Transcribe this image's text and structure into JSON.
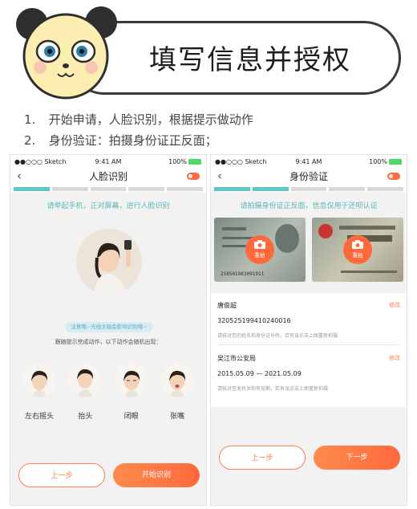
{
  "header": {
    "title": "填写信息并授权"
  },
  "steps": [
    {
      "num": "1.",
      "text": "开始申请，人脸识别，根据提示做动作"
    },
    {
      "num": "2.",
      "text": "身份验证：拍摄身份证正反面；"
    }
  ],
  "status": {
    "carrier": "●●○○○ Sketch",
    "time": "9:41 AM",
    "battery": "100%"
  },
  "face_screen": {
    "title": "人脸识别",
    "progress": [
      true,
      false,
      false,
      false,
      false
    ],
    "hint": "请举起手机，正对屏幕，进行人脸识别",
    "notice": "注意哦~光线太暗会影响识别哦~",
    "follow": "跟随提示完成动作，以下动作会随机出现：",
    "actions": [
      {
        "label": "左右摇头"
      },
      {
        "label": "抬头"
      },
      {
        "label": "闭眼"
      },
      {
        "label": "张嘴"
      }
    ],
    "prev_label": "上一步",
    "start_label": "开始识别"
  },
  "id_screen": {
    "title": "身份验证",
    "progress": [
      true,
      true,
      false,
      false,
      false
    ],
    "hint": "请拍摄身份证正反面，信息仅用于还呗认证",
    "retake_label": "重拍",
    "card_front_number": "210501983091911",
    "name": "唐俊超",
    "id_number": "320525199410240016",
    "id_tip": "请核对您的姓名和身份证号码，若有误点击上图重新拍摄",
    "authority": "吴江市公安局",
    "validity": "2015.05.09 — 2021.05.09",
    "authority_tip": "请核对签发机关和有效期，若有误点击上图重新拍摄",
    "edit_label": "修改",
    "prev_label": "上一步",
    "next_label": "下一步"
  },
  "colors": {
    "accent": "#ff6a3d",
    "progress": "#5fc6c4",
    "hint": "#5bb6b6"
  }
}
